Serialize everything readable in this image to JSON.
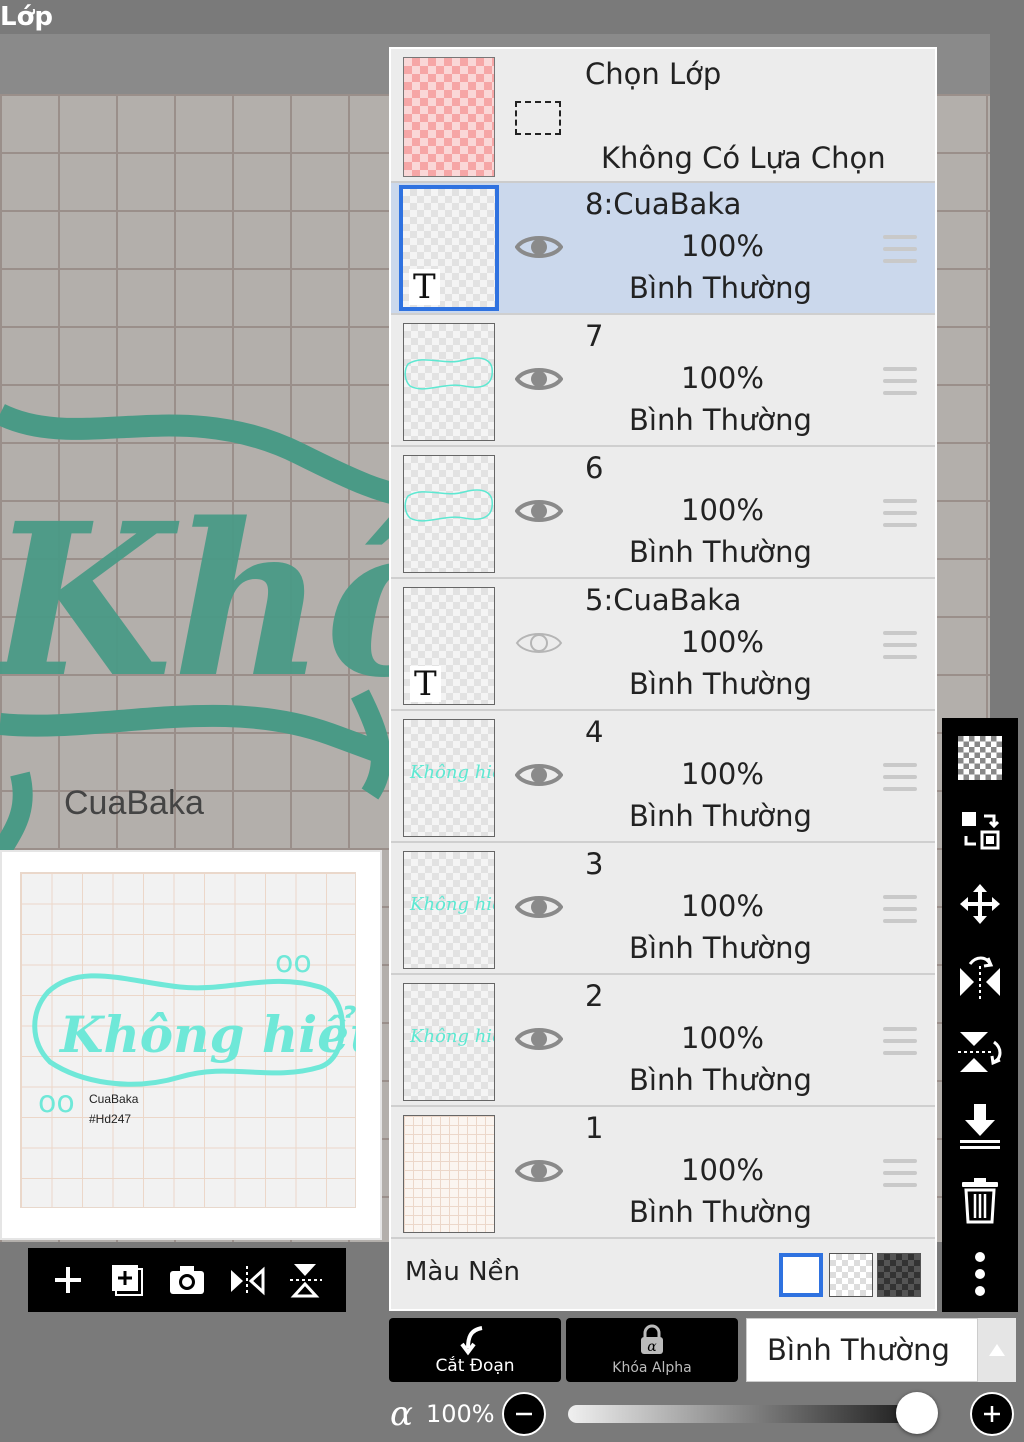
{
  "window": {
    "title": "Lớp"
  },
  "canvas": {
    "caption": "CuaBaka"
  },
  "preview": {
    "caption_name": "CuaBaka",
    "caption_tag": "#Hd247"
  },
  "selection": {
    "title": "Chọn Lớp",
    "status": "Không Có Lựa Chọn"
  },
  "layers": [
    {
      "name": "8:CuaBaka",
      "opacity": "100%",
      "blend": "Bình Thường",
      "visible": true,
      "selected": true,
      "kind": "text"
    },
    {
      "name": "7",
      "opacity": "100%",
      "blend": "Bình Thường",
      "visible": true,
      "selected": false,
      "kind": "outline"
    },
    {
      "name": "6",
      "opacity": "100%",
      "blend": "Bình Thường",
      "visible": true,
      "selected": false,
      "kind": "outline"
    },
    {
      "name": "5:CuaBaka",
      "opacity": "100%",
      "blend": "Bình Thường",
      "visible": false,
      "selected": false,
      "kind": "text"
    },
    {
      "name": "4",
      "opacity": "100%",
      "blend": "Bình Thường",
      "visible": true,
      "selected": false,
      "kind": "lettering"
    },
    {
      "name": "3",
      "opacity": "100%",
      "blend": "Bình Thường",
      "visible": true,
      "selected": false,
      "kind": "lettering"
    },
    {
      "name": "2",
      "opacity": "100%",
      "blend": "Bình Thường",
      "visible": true,
      "selected": false,
      "kind": "lettering"
    },
    {
      "name": "1",
      "opacity": "100%",
      "blend": "Bình Thường",
      "visible": true,
      "selected": false,
      "kind": "grid"
    }
  ],
  "background": {
    "label": "Màu Nền"
  },
  "bottom": {
    "clip_label": "Cắt Đoạn",
    "alpha_lock_label": "Khóa Alpha",
    "blend_mode": "Bình Thường",
    "alpha_symbol": "α",
    "opacity": "100%",
    "opacity_fraction": 0.97
  },
  "colors": {
    "accent": "#2f72e0",
    "selected_row": "#cbd8ec",
    "art": "#5ee8d2"
  },
  "icons": {
    "mini_toolbar": [
      "add-layer-icon",
      "add-layer-copy-icon",
      "camera-icon",
      "flip-horizontal-icon",
      "flip-vertical-icon"
    ],
    "side_toolbar": [
      "transparency-icon",
      "transfer-icon",
      "move-icon",
      "flip-horizontal-icon",
      "flip-vertical-icon",
      "merge-down-icon",
      "trash-icon",
      "more-icon"
    ]
  }
}
